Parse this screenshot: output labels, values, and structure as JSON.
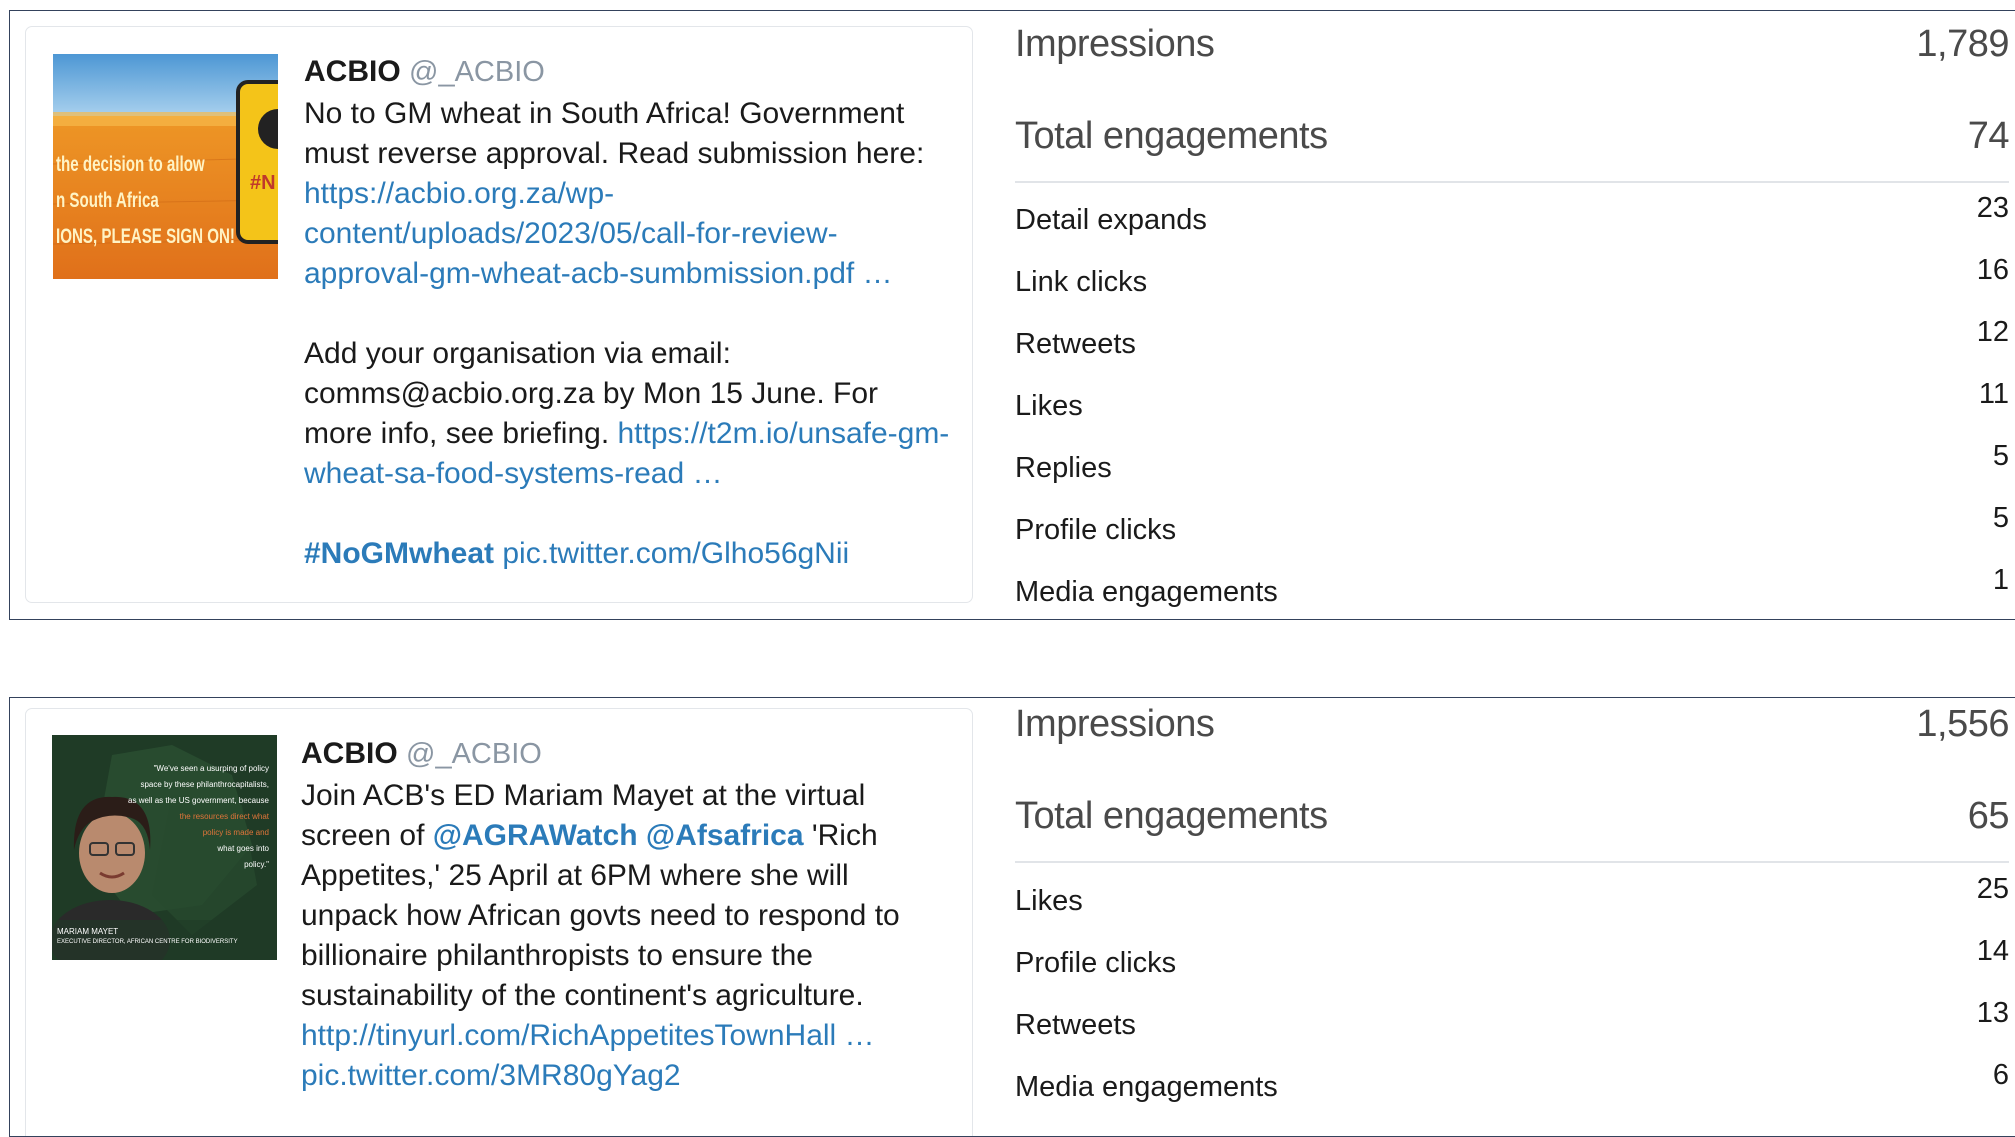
{
  "tweets": [
    {
      "author": "ACBIO",
      "handle": "@_ACBIO",
      "image": {
        "lines": [
          "the decision to allow",
          "n South Africa",
          "IONS, PLEASE SIGN ON!"
        ],
        "colors": {
          "sky": "#5aa3d8",
          "field": "#e8901a",
          "sign": "#f2c218"
        }
      },
      "text": {
        "p1_text": "No to GM wheat in South Africa! Government must reverse approval. Read submission here: ",
        "p1_link": "https://acbio.org.za/wp-content/uploads/2023/05/call-for-review-approval-gm-wheat-acb-sumbmission.pdf …",
        "p2_text": "Add your organisation via email: comms@acbio.org.za by Mon 15 June. For more info, see briefing. ",
        "p2_link": "https://t2m.io/unsafe-gm-wheat-sa-food-systems-read …",
        "hashtag": "#NoGMwheat",
        "pic": "pic.twitter.com/Glho56gNii"
      },
      "metrics": {
        "impressions_label": "Impressions",
        "impressions": "1,789",
        "engagements_label": "Total engagements",
        "engagements": "74",
        "breakdown": [
          {
            "label": "Detail expands",
            "value": "23"
          },
          {
            "label": "Link clicks",
            "value": "16"
          },
          {
            "label": "Retweets",
            "value": "12"
          },
          {
            "label": "Likes",
            "value": "11"
          },
          {
            "label": "Replies",
            "value": "5"
          },
          {
            "label": "Profile clicks",
            "value": "5"
          },
          {
            "label": "Media engagements",
            "value": "1"
          }
        ]
      }
    },
    {
      "author": "ACBIO",
      "handle": "@_ACBIO",
      "image": {
        "quote": [
          "\"We've seen a usurping of policy",
          "space by these philanthrocapitalists,",
          "as well as the US government, because",
          "the resources direct what",
          "policy is made and",
          "what goes into",
          "policy.\""
        ],
        "name": "MARIAM MAYET",
        "caption": "EXECUTIVE DIRECTOR, AFRICAN CENTRE FOR BIODIVERSITY",
        "colors": {
          "bg": "#1f3b26",
          "accent": "#e0753a"
        }
      },
      "text": {
        "p1_a": "Join ACB's ED Mariam Mayet at the virtual screen of ",
        "mention1": "@AGRAWatch",
        "mention2": "@Afsafrica",
        "p1_b": " 'Rich Appetites,' 25 April at 6PM where she will unpack how African govts need to respond to billionaire philanthropists to ensure the sustainability of the continent's agriculture.",
        "link": "http://tinyurl.com/RichAppetitesTownHall …",
        "pic": "pic.twitter.com/3MR80gYag2"
      },
      "metrics": {
        "impressions_label": "Impressions",
        "impressions": "1,556",
        "engagements_label": "Total engagements",
        "engagements": "65",
        "breakdown": [
          {
            "label": "Likes",
            "value": "25"
          },
          {
            "label": "Profile clicks",
            "value": "14"
          },
          {
            "label": "Retweets",
            "value": "13"
          },
          {
            "label": "Media engagements",
            "value": "6"
          }
        ]
      }
    }
  ]
}
